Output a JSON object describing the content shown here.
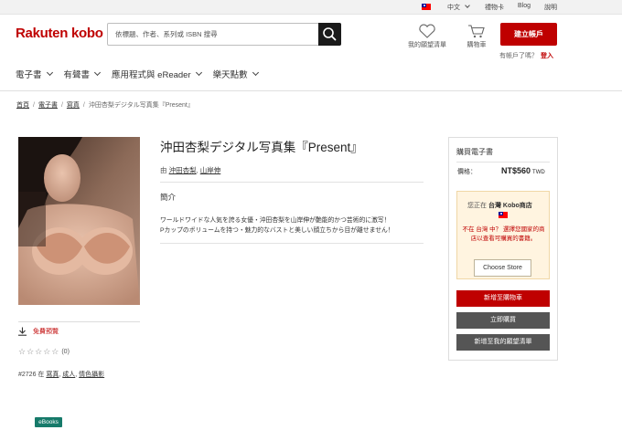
{
  "topbar": {
    "language": "中文",
    "gift_card": "禮物卡",
    "blog": "Blog",
    "help": "說明"
  },
  "header": {
    "logo": "Rakuten kobo",
    "search_placeholder": "依標題、作者、系列或 ISBN 搜尋",
    "wishlist": "我的願望清單",
    "cart": "購物車",
    "signup": "建立帳戶",
    "have_account": "有帳戶了嗎？",
    "login": "登入"
  },
  "nav": {
    "items": [
      "電子書",
      "有聲書",
      "應用程式與 eReader",
      "樂天點數"
    ]
  },
  "breadcrumb": {
    "items": [
      "首頁",
      "電子書",
      "寫真"
    ],
    "current": "沖田杏梨デジタル写真集『Present』"
  },
  "book": {
    "title": "沖田杏梨デジタル写真集『Present』",
    "by_prefix": "由",
    "authors": [
      "沖田杏梨",
      "山岸伸"
    ],
    "synopsis_heading": "簡介",
    "description": [
      "ワールドワイドな人気を誇る女優・沖田杏梨を山岸伸が艶能的かつ芸術的に激写！",
      "Pカップのボリュームを持つ・魅力的なバストと美しい顔立ちから目が離せません！"
    ],
    "preview_label": "免費預覽",
    "stars": "☆☆☆☆☆",
    "rating_count": "(0)",
    "rank": "#2726",
    "rank_in": "在",
    "categories": [
      "寫真",
      "成人",
      "情色攝影"
    ],
    "format_badge": "eBooks"
  },
  "purchase": {
    "title": "購買電子書",
    "price_label": "價格：",
    "price": "NT$560",
    "currency": "TWD",
    "store_prefix": "您正在",
    "store_name": "台灣 Kobo商店",
    "warning": "不在 台灣 中？ 選擇您國家的商店以查看可購買的書籍。",
    "choose_store": "Choose Store",
    "add_to_cart": "新增至購物車",
    "buy_now": "立即購買",
    "add_to_wishlist": "新增至我的願望清單"
  },
  "colors": {
    "brand_red": "#bf0000",
    "dark_button": "#555555",
    "store_bg": "#fff4e0",
    "badge_green": "#167a6a"
  }
}
